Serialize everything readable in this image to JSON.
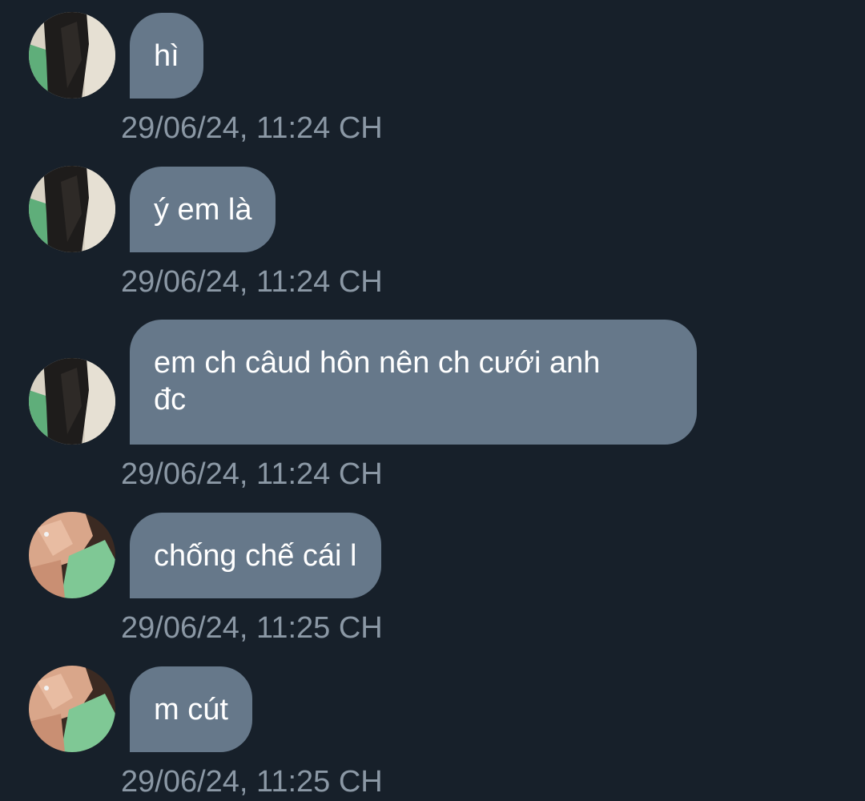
{
  "messages": [
    {
      "text": "hì",
      "timestamp": "29/06/24, 11:24 CH",
      "avatar": "avatar-dark-outfit"
    },
    {
      "text": "ý em là",
      "timestamp": "29/06/24, 11:24 CH",
      "avatar": "avatar-dark-outfit"
    },
    {
      "text": "em ch câud hôn nên ch cưới anh\nđc",
      "timestamp": "29/06/24, 11:24 CH",
      "avatar": "avatar-dark-outfit"
    },
    {
      "text": "chống chế cái l",
      "timestamp": "29/06/24, 11:25 CH",
      "avatar": "avatar-green-shirt"
    },
    {
      "text": "m cút",
      "timestamp": "29/06/24, 11:25 CH",
      "avatar": "avatar-green-shirt"
    }
  ],
  "colors": {
    "background": "#17202a",
    "bubble": "#66788a",
    "timestamp": "#8b98a5",
    "text": "#ffffff"
  }
}
